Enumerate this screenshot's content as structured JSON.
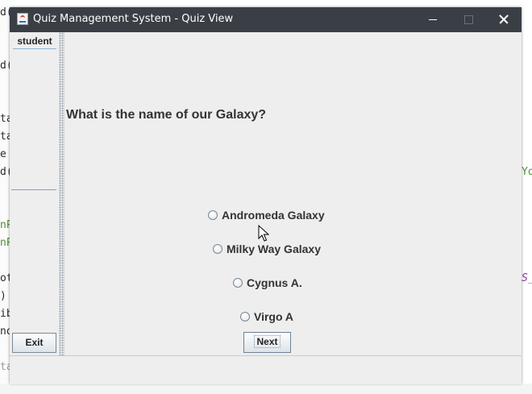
{
  "window": {
    "title": "Quiz Management System - Quiz View"
  },
  "sidebar": {
    "student_label": "student",
    "exit_label": "Exit"
  },
  "quiz": {
    "question": "What is the name of our Galaxy?",
    "options": [
      {
        "label": "Andromeda Galaxy",
        "selected": false
      },
      {
        "label": "Milky Way Galaxy",
        "selected": false
      },
      {
        "label": "Cygnus A.",
        "selected": false
      },
      {
        "label": "Virgo A",
        "selected": false
      }
    ],
    "next_label": "Next"
  },
  "background_editor": {
    "left_fragments": [
      "d(",
      "d(",
      "ta",
      "ta",
      "e",
      "d(",
      "nP",
      "nP",
      "ot",
      ")",
      "ib",
      "no",
      "ta"
    ],
    "right_fragments": [
      "Yo",
      "S_"
    ]
  },
  "colors": {
    "titlebar": "#3a3f46",
    "window_bg": "#eeeeee",
    "editor_green": "#4f8f3a",
    "editor_purple": "#8a3aa8"
  },
  "icons": {
    "app": "java-coffee-cup-icon",
    "minimize": "minimize-icon",
    "maximize": "maximize-icon",
    "close": "close-icon",
    "radio": "radio-button-icon",
    "cursor": "mouse-pointer-icon"
  }
}
